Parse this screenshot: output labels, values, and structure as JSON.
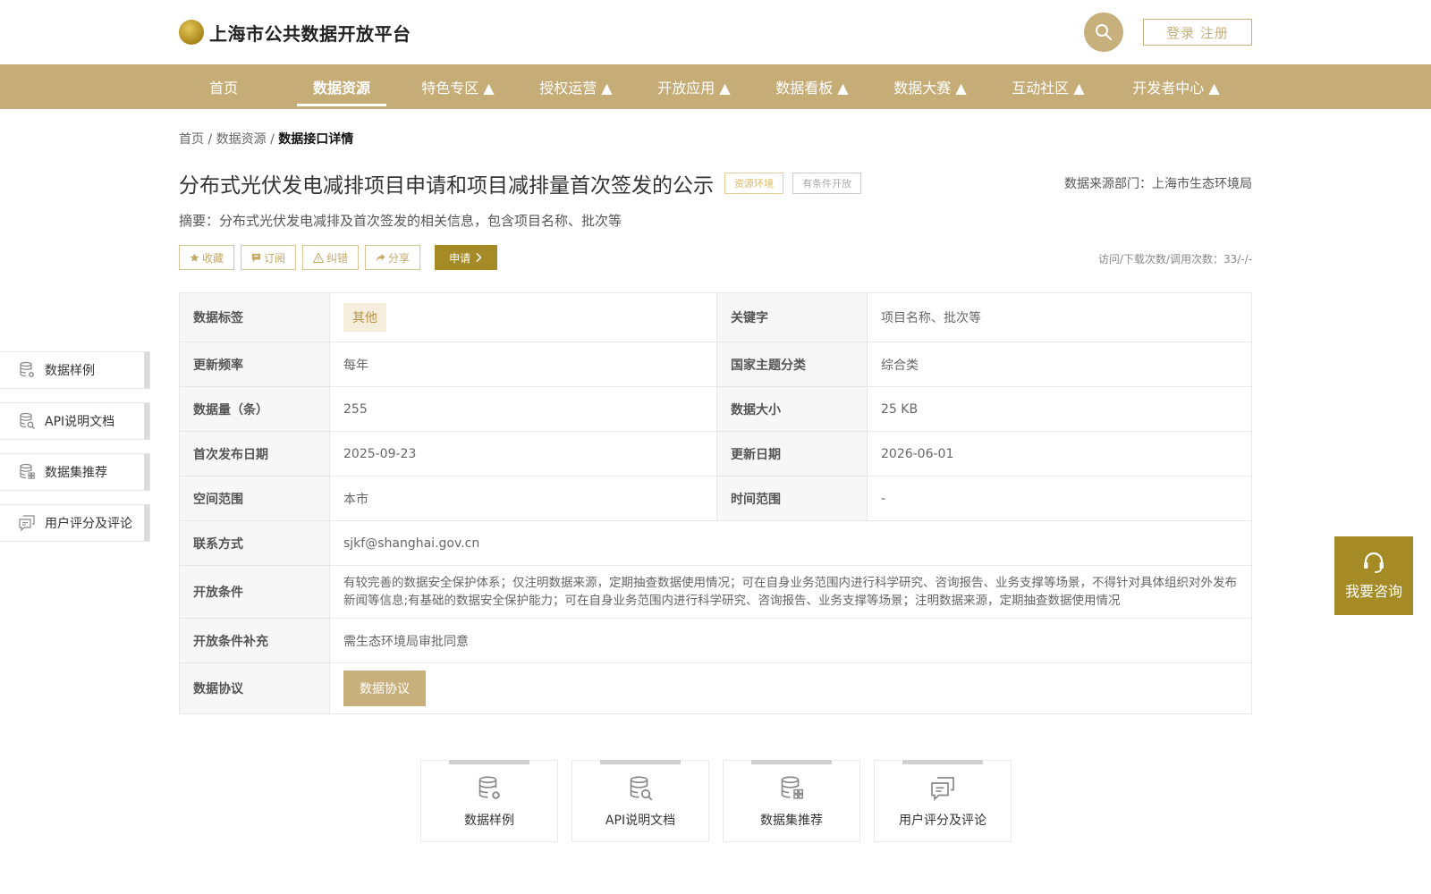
{
  "header": {
    "site_title": "上海市公共数据开放平台",
    "login_label": "登录 注册"
  },
  "nav": {
    "items": [
      {
        "label": "首页"
      },
      {
        "label": "数据资源"
      },
      {
        "label": "特色专区 ▲"
      },
      {
        "label": "授权运营 ▲"
      },
      {
        "label": "开放应用 ▲"
      },
      {
        "label": "数据看板 ▲"
      },
      {
        "label": "数据大赛 ▲"
      },
      {
        "label": "互动社区 ▲"
      },
      {
        "label": "开发者中心 ▲"
      }
    ],
    "active": "数据资源"
  },
  "breadcrumb": {
    "home": "首页",
    "sep1": " / ",
    "section": "数据资源",
    "sep2": " / ",
    "current": "数据接口详情"
  },
  "dataset": {
    "title": "分布式光伏发电减排项目申请和项目减排量首次签发的公示",
    "tag_domain": "资源环境",
    "tag_open": "有条件开放",
    "source": "数据来源部门：上海市生态环境局",
    "summary": "摘要：分布式光伏发电减排及首次签发的相关信息，包含项目名称、批次等",
    "visits": "访问/下载次数/调用次数：33/-/-"
  },
  "actions": {
    "favorite": "收藏",
    "subscribe": "订阅",
    "report": "纠错",
    "share": "分享",
    "apply": "申请"
  },
  "info": {
    "tags_label": "数据标签",
    "tags_value": "其他",
    "keywords_label": "关键字",
    "keywords_value": "项目名称、批次等",
    "freq_label": "更新频率",
    "freq_value": "每年",
    "theme_label": "国家主题分类",
    "theme_value": "综合类",
    "count_label": "数据量（条）",
    "count_value": "255",
    "size_label": "数据大小",
    "size_value": "25 KB",
    "pubdate_label": "首次发布日期",
    "pubdate_value": "2025-09-23",
    "update_label": "更新日期",
    "update_value": "2026-06-01",
    "space_label": "空间范围",
    "space_value": "本市",
    "time_label": "时间范围",
    "time_value": "-",
    "contact_label": "联系方式",
    "contact_value": "sjkf@shanghai.gov.cn",
    "cond_label": "开放条件",
    "cond_value": "有较完善的数据安全保护体系；仅注明数据来源，定期抽查数据使用情况；可在自身业务范围内进行科学研究、咨询报告、业务支撑等场景，不得针对具体组织对外发布新闻等信息;有基础的数据安全保护能力；可在自身业务范围内进行科学研究、咨询报告、业务支撑等场景；注明数据来源，定期抽查数据使用情况",
    "cond_extra_label": "开放条件补充",
    "cond_extra_value": "需生态环境局审批同意",
    "agreement_label": "数据协议",
    "agreement_button": "数据协议"
  },
  "side_nav": [
    {
      "label": "数据样例",
      "icon": "database-gear-icon"
    },
    {
      "label": "API说明文档",
      "icon": "database-search-icon"
    },
    {
      "label": "数据集推荐",
      "icon": "database-grid-icon"
    },
    {
      "label": "用户评分及评论",
      "icon": "comment-icon"
    }
  ],
  "consult": {
    "label": "我要咨询",
    "icon": "headset-icon"
  },
  "bottom_cards": [
    {
      "label": "数据样例"
    },
    {
      "label": "API说明文档"
    },
    {
      "label": "数据集推荐"
    },
    {
      "label": "用户评分及评论"
    }
  ],
  "colors": {
    "brand": "#c6ad78",
    "accent_dark": "#a48b26",
    "tag_gold": "#e0b860"
  }
}
